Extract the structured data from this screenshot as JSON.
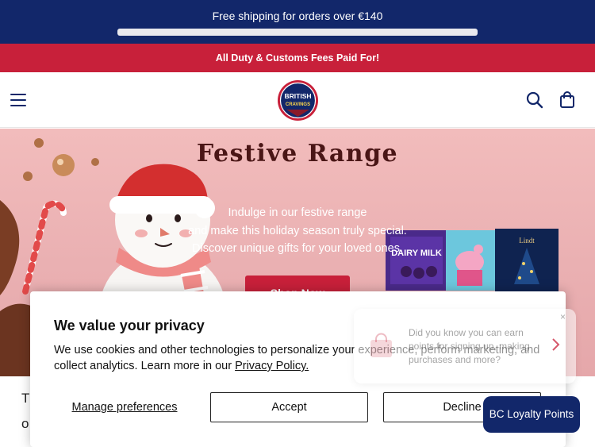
{
  "announcements": {
    "shipping": "Free shipping for orders over €140",
    "shipping_progress": 0,
    "duty": "All Duty & Customs Fees Paid For!"
  },
  "header": {
    "logo_text_1": "BRITISH",
    "logo_text_2": "CRAVINGS",
    "icons": [
      "menu-icon",
      "search-icon",
      "shopping-bag-icon"
    ]
  },
  "hero": {
    "title": "Festive Range",
    "lines": [
      "Indulge in our festive range",
      "and make this holiday season truly special.",
      "Discover unique gifts for your loved ones."
    ],
    "cta": "Shop Now",
    "products": [
      "DAIRY MILK",
      "Lindt"
    ]
  },
  "below": {
    "line1": "Th",
    "line2": "o"
  },
  "cookie": {
    "title": "We value your privacy",
    "body": "We use cookies and other technologies to personalize your experience, perform marketing, and collect analytics. Learn more in our ",
    "policy_link": "Privacy Policy.",
    "manage": "Manage preferences",
    "accept": "Accept",
    "decline": "Decline"
  },
  "loyalty": {
    "popup_text": "Did you know you can earn points for signing up, making purchases and more?",
    "close": "×",
    "button": "BC Loyalty Points"
  },
  "colors": {
    "navy": "#12276a",
    "red": "#c8203a",
    "hero_pink": "#eab0b2"
  }
}
